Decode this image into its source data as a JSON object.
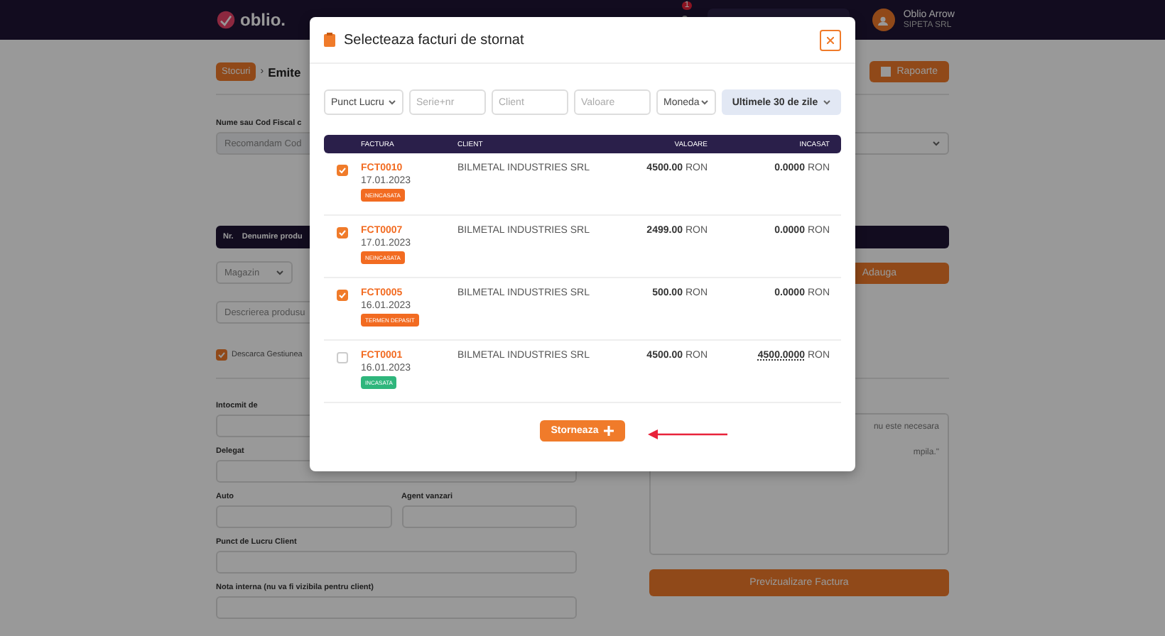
{
  "topbar": {
    "logo": "oblio.",
    "notification_count": "1",
    "user": {
      "name": "Oblio Arrow",
      "company": "SIPETA SRL"
    }
  },
  "page": {
    "breadcrumb": {
      "link": "Stocuri",
      "separator": "›",
      "title": "Emite"
    },
    "reports_button": "Rapoarte",
    "client_label": "Nume sau Cod Fiscal c",
    "client_placeholder": "Recomandam Cod",
    "product_columns": [
      "Nr.",
      "Denumire produ"
    ],
    "warehouse": "Magazin",
    "description_placeholder": "Descrierea produsu",
    "add_button": "Adauga",
    "stock_checkbox": {
      "label": "Descarca Gestiunea",
      "checked": true
    },
    "fields": [
      {
        "label": "Intocmit de"
      },
      {
        "label": "Delegat"
      }
    ],
    "half_fields": [
      {
        "label": "Auto"
      },
      {
        "label": "Agent vanzari"
      }
    ],
    "more_fields": [
      {
        "label": "Punct de Lucru Client"
      },
      {
        "label": "Nota interna (nu va fi vizibila pentru client)"
      }
    ],
    "notes_lines": [
      "nu este necesara",
      "mpila.\""
    ],
    "preview_button": "Previzualizare Factura"
  },
  "modal": {
    "title": "Selecteaza facturi de stornat",
    "filters": [
      {
        "kind": "select",
        "text": "Punct Lucru"
      },
      {
        "kind": "input",
        "text": "Serie+nr"
      },
      {
        "kind": "input",
        "text": "Client"
      },
      {
        "kind": "input",
        "text": "Valoare"
      },
      {
        "kind": "select",
        "text": "Moneda"
      }
    ],
    "period_button": "Ultimele 30 de zile",
    "columns": [
      "FACTURA",
      "CLIENT",
      "VALOARE",
      "INCASAT"
    ],
    "rows": [
      {
        "checked": true,
        "number": "FCT0010",
        "date": "17.01.2023",
        "status": {
          "label": "NEINCASATA",
          "color": "#f26b21"
        },
        "client": "BILMETAL INDUSTRIES SRL",
        "value": "4500.00",
        "value_currency": "RON",
        "collected": "0.0000",
        "collected_currency": "RON",
        "collected_link": false
      },
      {
        "checked": true,
        "number": "FCT0007",
        "date": "17.01.2023",
        "status": {
          "label": "NEINCASATA",
          "color": "#f26b21"
        },
        "client": "BILMETAL INDUSTRIES SRL",
        "value": "2499.00",
        "value_currency": "RON",
        "collected": "0.0000",
        "collected_currency": "RON",
        "collected_link": false
      },
      {
        "checked": true,
        "number": "FCT0005",
        "date": "16.01.2023",
        "status": {
          "label": "TERMEN DEPASIT",
          "color": "#f26b21"
        },
        "client": "BILMETAL INDUSTRIES SRL",
        "value": "500.00",
        "value_currency": "RON",
        "collected": "0.0000",
        "collected_currency": "RON",
        "collected_link": false
      },
      {
        "checked": false,
        "number": "FCT0001",
        "date": "16.01.2023",
        "status": {
          "label": "INCASATA",
          "color": "#2fb67c"
        },
        "client": "BILMETAL INDUSTRIES SRL",
        "value": "4500.00",
        "value_currency": "RON",
        "collected": "4500.0000",
        "collected_currency": "RON",
        "collected_link": true
      }
    ],
    "submit_button": "Storneaza"
  }
}
